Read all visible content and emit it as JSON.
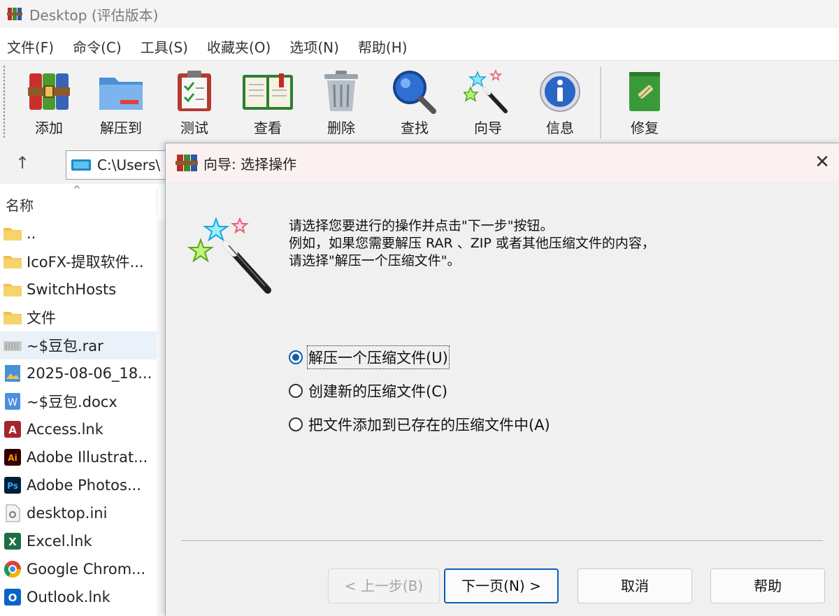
{
  "window": {
    "title": "Desktop (评估版本)"
  },
  "menu": [
    "文件(F)",
    "命令(C)",
    "工具(S)",
    "收藏夹(O)",
    "选项(N)",
    "帮助(H)"
  ],
  "toolbar": {
    "add": "添加",
    "extract_to": "解压到",
    "test": "测试",
    "view": "查看",
    "delete": "删除",
    "find": "查找",
    "wizard": "向导",
    "info": "信息",
    "repair": "修复"
  },
  "address": {
    "path": "C:\\Users\\"
  },
  "column": {
    "name": "名称"
  },
  "files": [
    "..",
    "IcoFX-提取软件...",
    "SwitchHosts",
    "文件",
    "~$豆包.rar",
    "2025-08-06_18...",
    "~$豆包.docx",
    "Access.lnk",
    "Adobe Illustrat...",
    "Adobe Photos...",
    "desktop.ini",
    "Excel.lnk",
    "Google Chrom...",
    "Outlook.lnk"
  ],
  "dialog": {
    "title": "向导: 选择操作",
    "desc_line1": "请选择您要进行的操作并点击\"下一步\"按钮。",
    "desc_line2": "例如，如果您需要解压 RAR 、ZIP 或者其他压缩文件的内容，",
    "desc_line3": "请选择\"解压一个压缩文件\"。",
    "options": [
      "解压一个压缩文件(U)",
      "创建新的压缩文件(C)",
      "把文件添加到已存在的压缩文件中(A)"
    ],
    "selected_option": 0,
    "buttons": {
      "back": "< 上一步(B)",
      "next": "下一页(N) >",
      "cancel": "取消",
      "help": "帮助"
    }
  }
}
